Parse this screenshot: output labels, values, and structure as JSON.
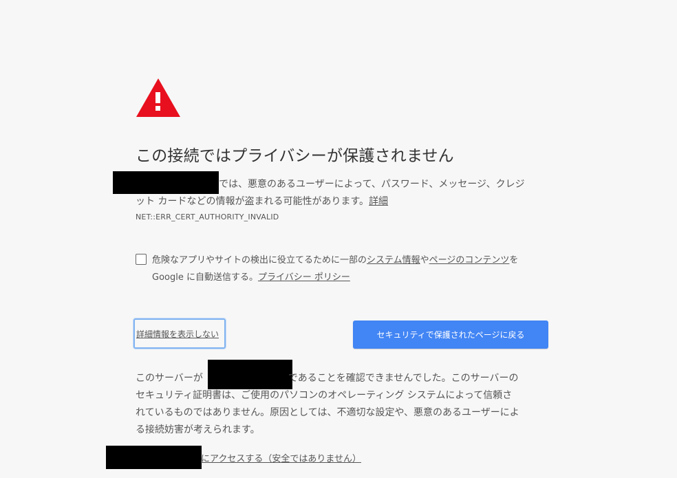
{
  "heading": "この接続ではプライバシーが保護されません",
  "main": {
    "line1": "では、悪意のあるユーザーによって、パスワード、メッセージ、クレジ",
    "line2": "ット カードなどの情報が盗まれる可能性があります。",
    "learn_more": "詳細",
    "error_code": "NET::ERR_CERT_AUTHORITY_INVALID"
  },
  "report": {
    "text_a": "危険なアプリやサイトの検出に役立てるために一部の",
    "link_system_info": "システム情報",
    "text_b": "や",
    "link_page_content": "ページのコンテンツ",
    "text_c": "を",
    "text_d": "Google に自動送信する。",
    "link_privacy": "プライバシー ポリシー",
    "checked": false
  },
  "buttons": {
    "hide_details": "詳細情報を表示しない",
    "back_to_safety": "セキュリティで保護されたページに戻る"
  },
  "details": {
    "text_a": "このサーバーが",
    "text_b": "であることを確認できませんでした。このサーバーの",
    "line2": "セキュリティ証明書は、ご使用のパソコンのオペレーティング システムによって信頼さ",
    "line3": "れているものではありません。原因としては、不適切な設定や、悪意のあるユーザーによ",
    "line4": "る接続妨害が考えられます。"
  },
  "proceed_link": "にアクセスする（安全ではありません）",
  "colors": {
    "warning_red": "#e8101e",
    "button_blue": "#4285f4",
    "focus_ring": "#82b4f0",
    "background": "#f7f7f7"
  },
  "icons": {
    "warning": "warning-triangle-icon"
  }
}
